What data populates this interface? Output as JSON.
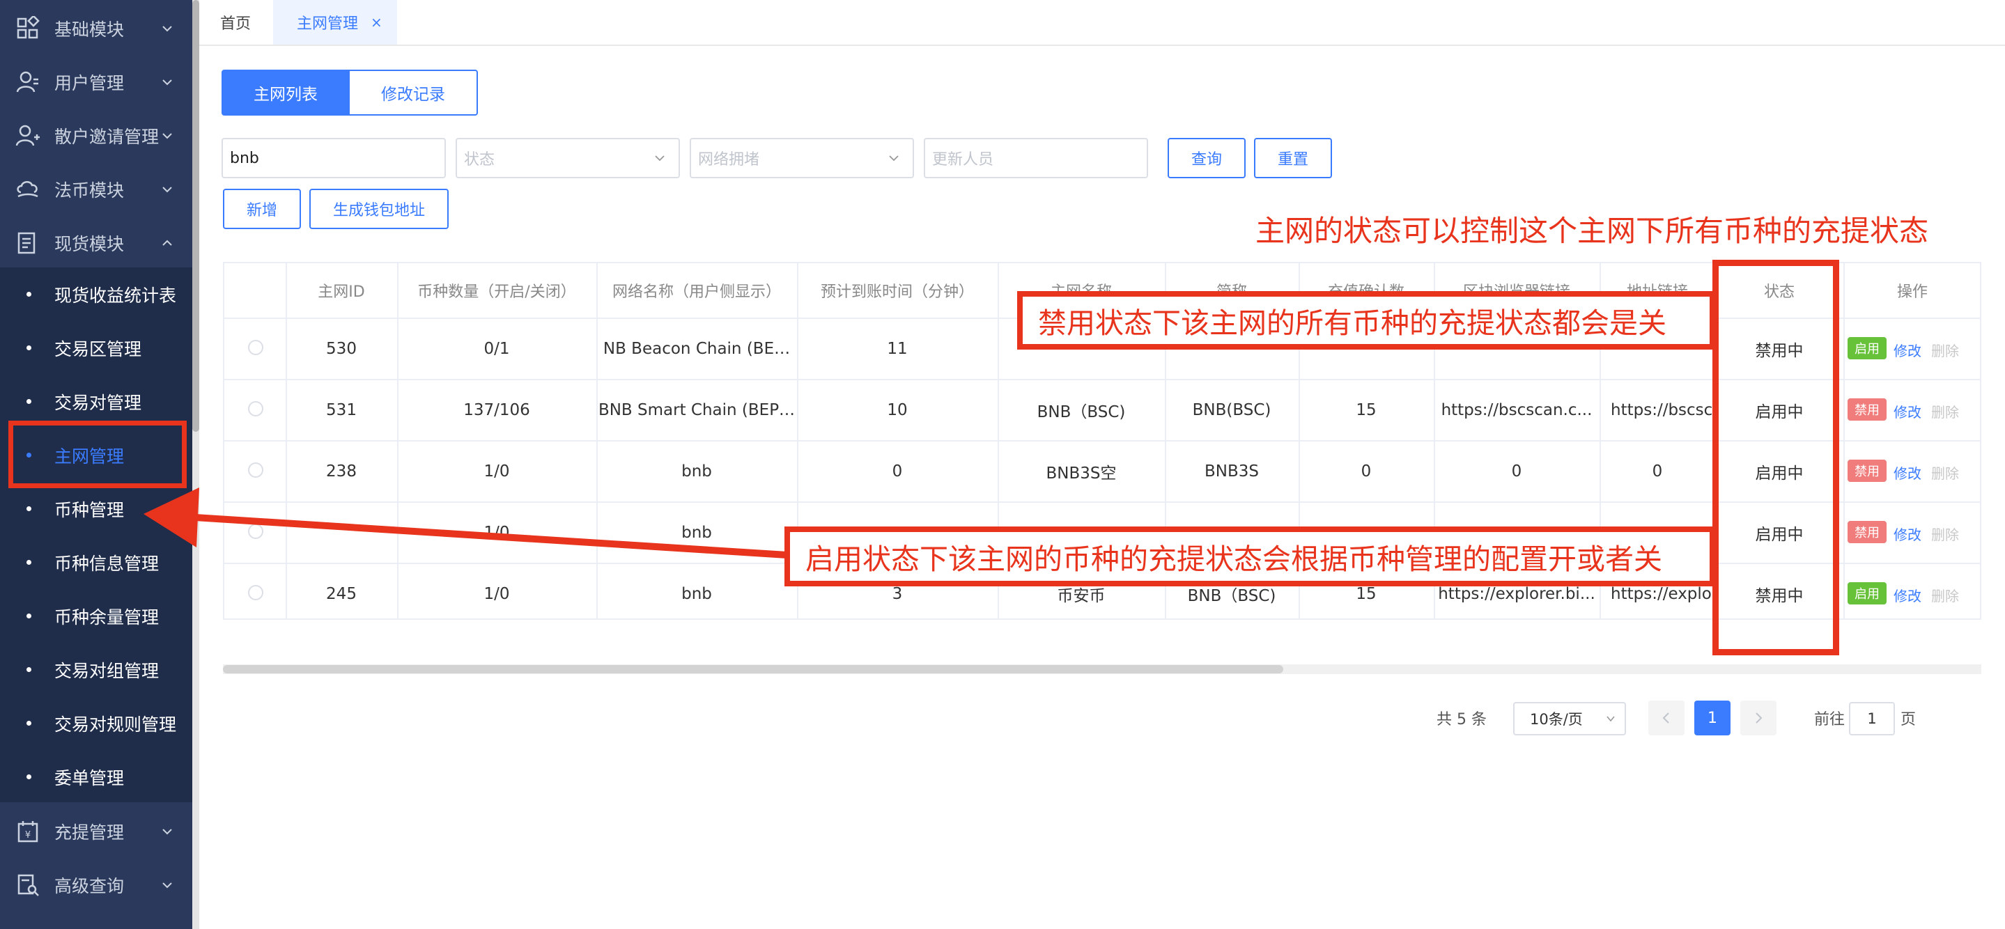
{
  "sidebar": {
    "top_items": [
      {
        "label": "基础模块",
        "icon": "grid-icon"
      },
      {
        "label": "用户管理",
        "icon": "user-icon"
      },
      {
        "label": "散户邀请管理",
        "icon": "user-plus-icon"
      },
      {
        "label": "法币模块",
        "icon": "cloud-icon"
      },
      {
        "label": "现货模块",
        "icon": "doc-list-icon"
      }
    ],
    "sub_items": [
      {
        "label": "现货收益统计表"
      },
      {
        "label": "交易区管理"
      },
      {
        "label": "交易对管理"
      },
      {
        "label": "主网管理"
      },
      {
        "label": "币种管理"
      },
      {
        "label": "币种信息管理"
      },
      {
        "label": "币种余量管理"
      },
      {
        "label": "交易对组管理"
      },
      {
        "label": "交易对规则管理"
      },
      {
        "label": "委单管理"
      }
    ],
    "bottom_items": [
      {
        "label": "充提管理",
        "icon": "calendar-icon"
      },
      {
        "label": "高级查询",
        "icon": "search-doc-icon"
      }
    ]
  },
  "tabs": {
    "home": "首页",
    "mainnet": "主网管理",
    "close": "×"
  },
  "segmented": {
    "list": "主网列表",
    "log": "修改记录"
  },
  "filters": {
    "keyword_value": "bnb",
    "status_placeholder": "状态",
    "network_placeholder": "网络拥堵",
    "updater_placeholder": "更新人员",
    "query": "查询",
    "reset": "重置",
    "add": "新增",
    "gen_wallet": "生成钱包地址"
  },
  "table": {
    "headers": [
      "主网ID",
      "币种数量（开启/关闭）",
      "网络名称（用户侧显示）",
      "预计到账时间（分钟）",
      "主网名称",
      "简称",
      "充值确认数",
      "区块浏览器链接",
      "地址链接",
      "状态",
      "操作"
    ],
    "rows": [
      {
        "id": "530",
        "count": "0/1",
        "network": "NB Beacon Chain (BE…",
        "eta": "11",
        "name": "",
        "short": "",
        "confirm": "",
        "explorer": "",
        "addr": "",
        "status": "禁用中",
        "toggle": "启用",
        "toggle_type": "enable"
      },
      {
        "id": "531",
        "count": "137/106",
        "network": "BNB Smart Chain (BEP…",
        "eta": "10",
        "name": "BNB（BSC)",
        "short": "BNB(BSC)",
        "confirm": "15",
        "explorer": "https://bscscan.c...",
        "addr": "https://bscsca",
        "status": "启用中",
        "toggle": "禁用",
        "toggle_type": "disable"
      },
      {
        "id": "238",
        "count": "1/0",
        "network": "bnb",
        "eta": "0",
        "name": "BNB3S空",
        "short": "BNB3S",
        "confirm": "0",
        "explorer": "0",
        "addr": "0",
        "status": "启用中",
        "toggle": "禁用",
        "toggle_type": "disable"
      },
      {
        "id": "",
        "count": "1/0",
        "network": "bnb",
        "eta": "",
        "name": "",
        "short": "",
        "confirm": "",
        "explorer": "",
        "addr": "",
        "status": "启用中",
        "toggle": "禁用",
        "toggle_type": "disable"
      },
      {
        "id": "245",
        "count": "1/0",
        "network": "bnb",
        "eta": "3",
        "name": "币安币",
        "short": "BNB（BSC)",
        "confirm": "15",
        "explorer": "https://explorer.bi...",
        "addr": "https://explore",
        "status": "禁用中",
        "toggle": "启用",
        "toggle_type": "enable"
      }
    ],
    "edit": "修改",
    "delete": "删除"
  },
  "pagination": {
    "total": "共 5 条",
    "page_size": "10条/页",
    "current": "1",
    "goto_prefix": "前往",
    "goto_value": "1",
    "goto_suffix": "页"
  },
  "annotations": {
    "top_note": "主网的状态可以控制这个主网下所有币种的充提状态",
    "disabled_note": "禁用状态下该主网的所有币种的充提状态都会是关",
    "enabled_note": "启用状态下该主网的币种的充提状态会根据币种管理的配置开或者关"
  },
  "colors": {
    "sidebar_bg": "#2b3a5c",
    "submenu_bg": "#1f2d4b",
    "primary": "#3b7cff",
    "annotation": "#e8341c",
    "tag_enable": "#67c23a",
    "tag_disable": "#f07c7c"
  }
}
